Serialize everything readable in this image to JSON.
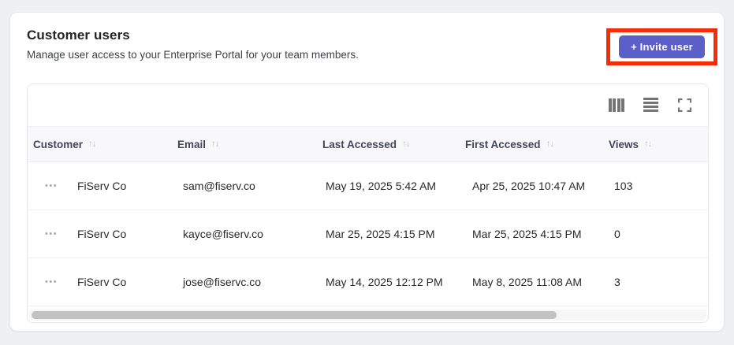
{
  "panel": {
    "title": "Customer users",
    "subtitle": "Manage user access to your Enterprise Portal for your team members."
  },
  "invite_button": {
    "label": "+ Invite user"
  },
  "colors": {
    "accent_button": "#5b5fc7",
    "annotation_highlight": "#f42d08",
    "table_header_bg": "#f8f8fb"
  },
  "toolbar": {
    "icons": [
      "columns-icon",
      "rows-icon",
      "maximize-icon"
    ]
  },
  "table": {
    "sort_icon": "↑↓",
    "row_menu_icon": "•••",
    "columns": [
      {
        "label": "Customer"
      },
      {
        "label": "Email"
      },
      {
        "label": "Last Accessed"
      },
      {
        "label": "First Accessed"
      },
      {
        "label": "Views"
      }
    ],
    "rows": [
      {
        "customer": "FiServ Co",
        "email": "sam@fiserv.co",
        "last_accessed": "May 19, 2025 5:42 AM",
        "first_accessed": "Apr 25, 2025 10:47 AM",
        "views": "103"
      },
      {
        "customer": "FiServ Co",
        "email": "kayce@fiserv.co",
        "last_accessed": "Mar 25, 2025 4:15 PM",
        "first_accessed": "Mar 25, 2025 4:15 PM",
        "views": "0"
      },
      {
        "customer": "FiServ Co",
        "email": "jose@fiservc.co",
        "last_accessed": "May 14, 2025 12:12 PM",
        "first_accessed": "May 8, 2025 11:08 AM",
        "views": "3"
      }
    ]
  }
}
